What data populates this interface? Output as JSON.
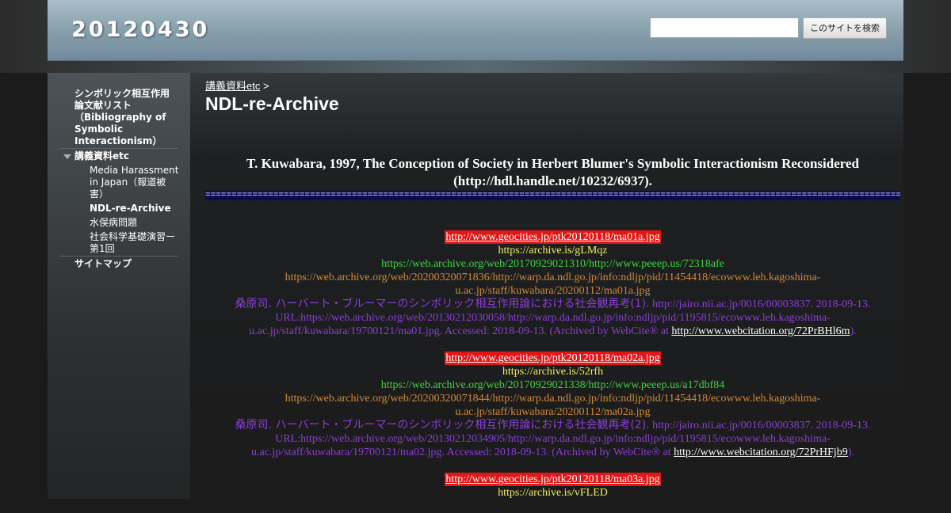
{
  "header": {
    "site_title": "20120430",
    "search_placeholder": "",
    "search_button": "このサイトを検索"
  },
  "sidebar": {
    "items": [
      {
        "label": "シンボリック相互作用論文献リスト（Bibliography of Symbolic Interactionism）",
        "line1": "シンボリック相互作用",
        "line2": "論文献リスト",
        "line3": "（Bibliography of",
        "line4": "Symbolic",
        "line5": "Interactionism）"
      },
      {
        "label": "講義資料etc",
        "expanded": true
      },
      {
        "label": "Media Harassment in Japan（報道被害）",
        "line1": "Media Harassment",
        "line2": "in Japan（報道被",
        "line3": "害）"
      },
      {
        "label": "NDL-re-Archive",
        "current": true
      },
      {
        "label": "水俣病問題"
      },
      {
        "label": "社会科学基礎演習ー第1回",
        "line1": "社会科学基礎演習ー",
        "line2": "第1回"
      },
      {
        "label": "サイトマップ"
      }
    ]
  },
  "breadcrumb": {
    "parent": "講義資料etc",
    "separator": ">"
  },
  "page_title": "NDL-re-Archive",
  "article": {
    "heading_line1": "T. Kuwabara, 1997, The Conception of Society in Herbert Blumer's Symbolic Interactionism Reconsidered",
    "heading_line2": "(http://hdl.handle.net/10232/6937).",
    "rule": "==================================================================================================================================================",
    "entries": [
      {
        "geocities": "http://www.geocities.jp/ptk20120118/ma01a.jpg",
        "archive_is": "https://archive.is/gLMqz",
        "wayback_peeep": "https://web.archive.org/web/20170929021310/http://www.peeep.us/72318afe",
        "wayback_ndl_1": "https://web.archive.org/web/20200320071836/http://warp.da.ndl.go.jp/info:ndljp/pid/11454418/ecowww.leh.kagoshima-",
        "wayback_ndl_2": "u.ac.jp/staff/kuwabara/20200112/ma01a.jpg",
        "kuwabara_jp": "桑原司. ハーバート・ブルーマーのシンボリック相互作用論における社会観再考(1).",
        "kuwabara_1_rest": " http://jairo.nii.ac.jp/0016/00003837. 2018-09-13.",
        "kuwabara_2": "URL:https://web.archive.org/web/20130212030058/http://warp.da.ndl.go.jp/info:ndljp/pid/1195815/ecowww.leh.kagoshima-",
        "kuwabara_3": "u.ac.jp/staff/kuwabara/19700121/ma01.jpg. Accessed: 2018-09-13. (Archived by WebCite® at ",
        "webcite": "http://www.webcitation.org/72PrBHl6m",
        "close": ")."
      },
      {
        "geocities": "http://www.geocities.jp/ptk20120118/ma02a.jpg",
        "archive_is": "https://archive.is/52rfh",
        "wayback_peeep": "https://web.archive.org/web/20170929021338/http://www.peeep.us/a17dbf84",
        "wayback_ndl_1": "https://web.archive.org/web/20200320071844/http://warp.da.ndl.go.jp/info:ndljp/pid/11454418/ecowww.leh.kagoshima-",
        "wayback_ndl_2": "u.ac.jp/staff/kuwabara/20200112/ma02a.jpg",
        "kuwabara_jp": "桑原司. ハーバート・ブルーマーのシンボリック相互作用論における社会観再考(2).",
        "kuwabara_1_rest": " http://jairo.nii.ac.jp/0016/00003837. 2018-09-13.",
        "kuwabara_2": "URL:https://web.archive.org/web/20130212034905/http://warp.da.ndl.go.jp/info:ndljp/pid/1195815/ecowww.leh.kagoshima-",
        "kuwabara_3": "u.ac.jp/staff/kuwabara/19700121/ma02.jpg. Accessed: 2018-09-13. (Archived by WebCite® at ",
        "webcite": "http://www.webcitation.org/72PrHFjb9",
        "close": ")."
      },
      {
        "geocities": "http://www.geocities.jp/ptk20120118/ma03a.jpg",
        "archive_is": "https://archive.is/vFLED"
      }
    ]
  },
  "colors": {
    "geocities_bg": "#e21616",
    "archive_is": "#f4f05a",
    "wayback_peeep": "#3cd63c",
    "wayback_ndl": "#d08a3a",
    "kuwabara": "#8a3ed6"
  }
}
